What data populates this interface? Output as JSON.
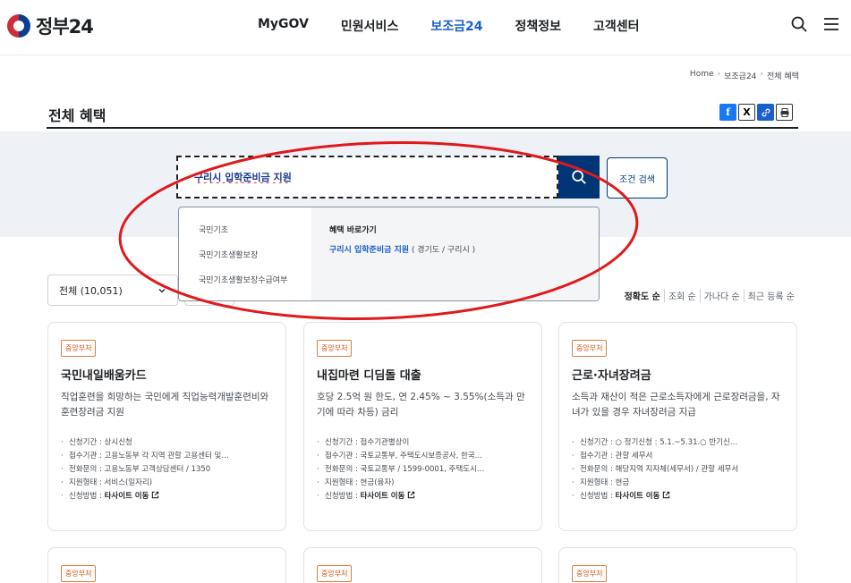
{
  "header": {
    "logo_text": "정부24",
    "nav": [
      {
        "label": "MyGOV",
        "active": false
      },
      {
        "label": "민원서비스",
        "active": false
      },
      {
        "label": "보조금24",
        "active": true
      },
      {
        "label": "정책정보",
        "active": false
      },
      {
        "label": "고객센터",
        "active": false
      }
    ],
    "icons": [
      "search-icon",
      "menu-icon"
    ]
  },
  "breadcrumb": [
    "Home",
    "보조금24",
    "전체 혜택"
  ],
  "page_title": "전체 혜택",
  "share": {
    "fb": "f",
    "x": "X"
  },
  "search": {
    "value": "구리시 입학준비금 지원",
    "condition_label": "조건 검색"
  },
  "autocomplete": {
    "suggestions": [
      "국민기초",
      "국민기초생활보장",
      "국민기초생활보장수급여부"
    ],
    "shortcut_heading": "혜택 바로가기",
    "shortcut_main": "구리시 입학준비금 지원",
    "shortcut_sub": " ( 경기도 / 구리시 )"
  },
  "filter": {
    "selected": "전체 (10,051)"
  },
  "sort": [
    {
      "label": "정확도 순",
      "active": true
    },
    {
      "label": "조회 순",
      "active": false
    },
    {
      "label": "가나다 순",
      "active": false
    },
    {
      "label": "최근 등록 순",
      "active": false
    }
  ],
  "cards": [
    {
      "badge": "중앙부처",
      "title": "국민내일배움카드",
      "desc": "직업훈련을 희망하는 국민에게 직업능력개발훈련비와 훈련장려금 지원",
      "info": [
        "신청기간 : 상시신청",
        "접수기관 : 고용노동부 각 지역 관할 고용센터 및…",
        "전화문의 : 고용노동부 고객상담센터 / 1350",
        "지원형태 : 서비스(일자리)"
      ],
      "method_label": "신청방법 : ",
      "method_link": "타사이트 이동"
    },
    {
      "badge": "중앙부처",
      "title": "내집마련 디딤돌 대출",
      "desc": "호당 2.5억 원 한도, 연 2.45% ~ 3.55%(소득과 만기에 따라 차등) 금리",
      "info": [
        "신청기간 : 접수기관별상이",
        "접수기관 : 국토교통부, 주택도시보증공사, 한국…",
        "전화문의 : 국토교통부 / 1599-0001, 주택도시…",
        "지원형태 : 현금(융자)"
      ],
      "method_label": "신청방법 : ",
      "method_link": "타사이트 이동"
    },
    {
      "badge": "중앙부처",
      "title": "근로·자녀장려금",
      "desc": "소득과 재산이 적은 근로소득자에게 근로장려금을, 자녀가 있을 경우 자녀장려금 지급",
      "info": [
        "신청기간 : ○ 정기신청 : 5.1.~5.31.○ 반기신…",
        "접수기관 : 관할 세무서",
        "전화문의 : 해당지역 지자체(세무서) / 관할 세무서",
        "지원형태 : 현금"
      ],
      "method_label": "신청방법 : ",
      "method_link": "타사이트 이동"
    }
  ],
  "cards_row2_badges": [
    "중앙부처",
    "중앙부처",
    "중앙부처"
  ],
  "colors": {
    "accent": "#1b5fcc",
    "search_button": "#003675",
    "badge": "#d2561b",
    "annotation": "#e0191c"
  }
}
